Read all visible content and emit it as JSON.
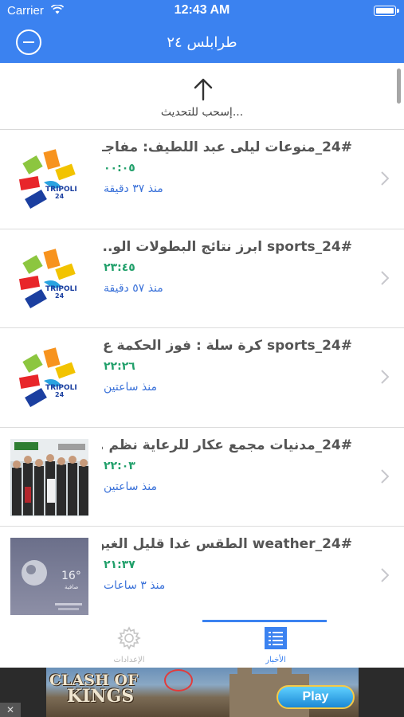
{
  "status_bar": {
    "carrier": "Carrier",
    "time": "12:43 AM"
  },
  "nav": {
    "title": "طرابلس ٢٤"
  },
  "pull_to_refresh": {
    "label": "...إسحب للتحديث"
  },
  "news": [
    {
      "headline": "24#_منوعات ليلى عبد اللطيف: مفاجـ...",
      "duration": "٠٠:٠٥",
      "age": "منذ ٣٧ دقيقة",
      "thumb": "tripoli24-logo"
    },
    {
      "headline": "24#_sports ابرز نتائج البطولات الو...",
      "duration": "٢٣:٤٥",
      "age": "منذ ٥٧ دقيقة",
      "thumb": "tripoli24-logo"
    },
    {
      "headline": "24#_sports كرة سلة : فوز الحكمة ع...",
      "duration": "٢٢:٢٦",
      "age": "منذ ساعتين",
      "thumb": "tripoli24-logo"
    },
    {
      "headline": "24#_مدنيات مجمع عكار للرعاية نظم ...",
      "duration": "٢٢:٠٣",
      "age": "منذ ساعتين",
      "thumb": "group-photo"
    },
    {
      "headline": "24#_weather الطقس غدا قليل الغيو...",
      "duration": "٢١:٣٧",
      "age": "منذ ٣ ساعات",
      "thumb": "weather-screen",
      "thumb_text": {
        "temp": "16°",
        "condition": "صافية"
      }
    }
  ],
  "tabs": [
    {
      "label": "الإعدادات",
      "icon": "gear-icon",
      "active": false
    },
    {
      "label": "الأخبار",
      "icon": "news-list-icon",
      "active": true
    }
  ],
  "ad": {
    "close": "✕",
    "logo_line1": "CLASH OF",
    "logo_line2": "KINGS",
    "play_label": "Play"
  },
  "colors": {
    "primary": "#3b82f0",
    "duration": "#22a06b",
    "age": "#3b72d9",
    "headline": "#555555"
  }
}
